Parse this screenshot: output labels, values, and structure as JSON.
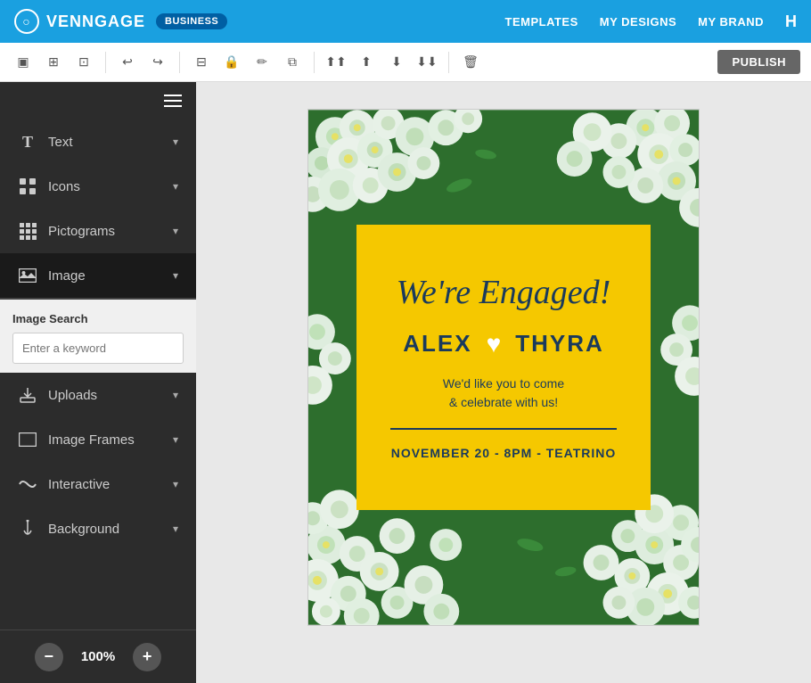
{
  "navbar": {
    "logo_text": "VENNGAGE",
    "badge_label": "BUSINESS",
    "links": [
      "TEMPLATES",
      "MY DESIGNS",
      "MY BRAND"
    ],
    "more_label": "H"
  },
  "toolbar": {
    "buttons": [
      {
        "name": "select-tool",
        "icon": "▣"
      },
      {
        "name": "page-tool",
        "icon": "⊞"
      },
      {
        "name": "image-tool",
        "icon": "⊡"
      },
      {
        "name": "undo-btn",
        "icon": "↩"
      },
      {
        "name": "redo-btn",
        "icon": "↪"
      },
      {
        "name": "crop-btn",
        "icon": "⊟"
      },
      {
        "name": "lock-btn",
        "icon": "🔒"
      },
      {
        "name": "edit-btn",
        "icon": "✏"
      },
      {
        "name": "copy-btn",
        "icon": "⧉"
      },
      {
        "name": "bring-front-btn",
        "icon": "⬆⬆"
      },
      {
        "name": "bring-up-btn",
        "icon": "⬆"
      },
      {
        "name": "send-down-btn",
        "icon": "⬇"
      },
      {
        "name": "send-back-btn",
        "icon": "⬇⬇"
      },
      {
        "name": "delete-btn",
        "icon": "🗑"
      }
    ],
    "publish_label": "PUBLISH"
  },
  "sidebar": {
    "items": [
      {
        "label": "Text",
        "icon": "T",
        "name": "text"
      },
      {
        "label": "Icons",
        "icon": "⊞",
        "name": "icons"
      },
      {
        "label": "Pictograms",
        "icon": "⊡",
        "name": "pictograms"
      },
      {
        "label": "Image",
        "icon": "🖼",
        "name": "image",
        "active": true
      },
      {
        "label": "Uploads",
        "icon": "⬆",
        "name": "uploads"
      },
      {
        "label": "Image Frames",
        "icon": "⬜",
        "name": "image-frames"
      },
      {
        "label": "Interactive",
        "icon": "⇄",
        "name": "interactive"
      },
      {
        "label": "Background",
        "icon": "🔔",
        "name": "background"
      }
    ],
    "image_search": {
      "title": "Image Search",
      "placeholder": "Enter a keyword"
    }
  },
  "bottom_bar": {
    "zoom_out_label": "−",
    "zoom_level": "100%",
    "zoom_in_label": "+"
  },
  "canvas": {
    "card": {
      "title": "We're Engaged!",
      "name_left": "ALEX",
      "name_right": "THYRA",
      "invite_line1": "We'd like you to come",
      "invite_line2": "& celebrate with us!",
      "event_details": "NOVEMBER 20 - 8PM - TEATRINO"
    }
  }
}
